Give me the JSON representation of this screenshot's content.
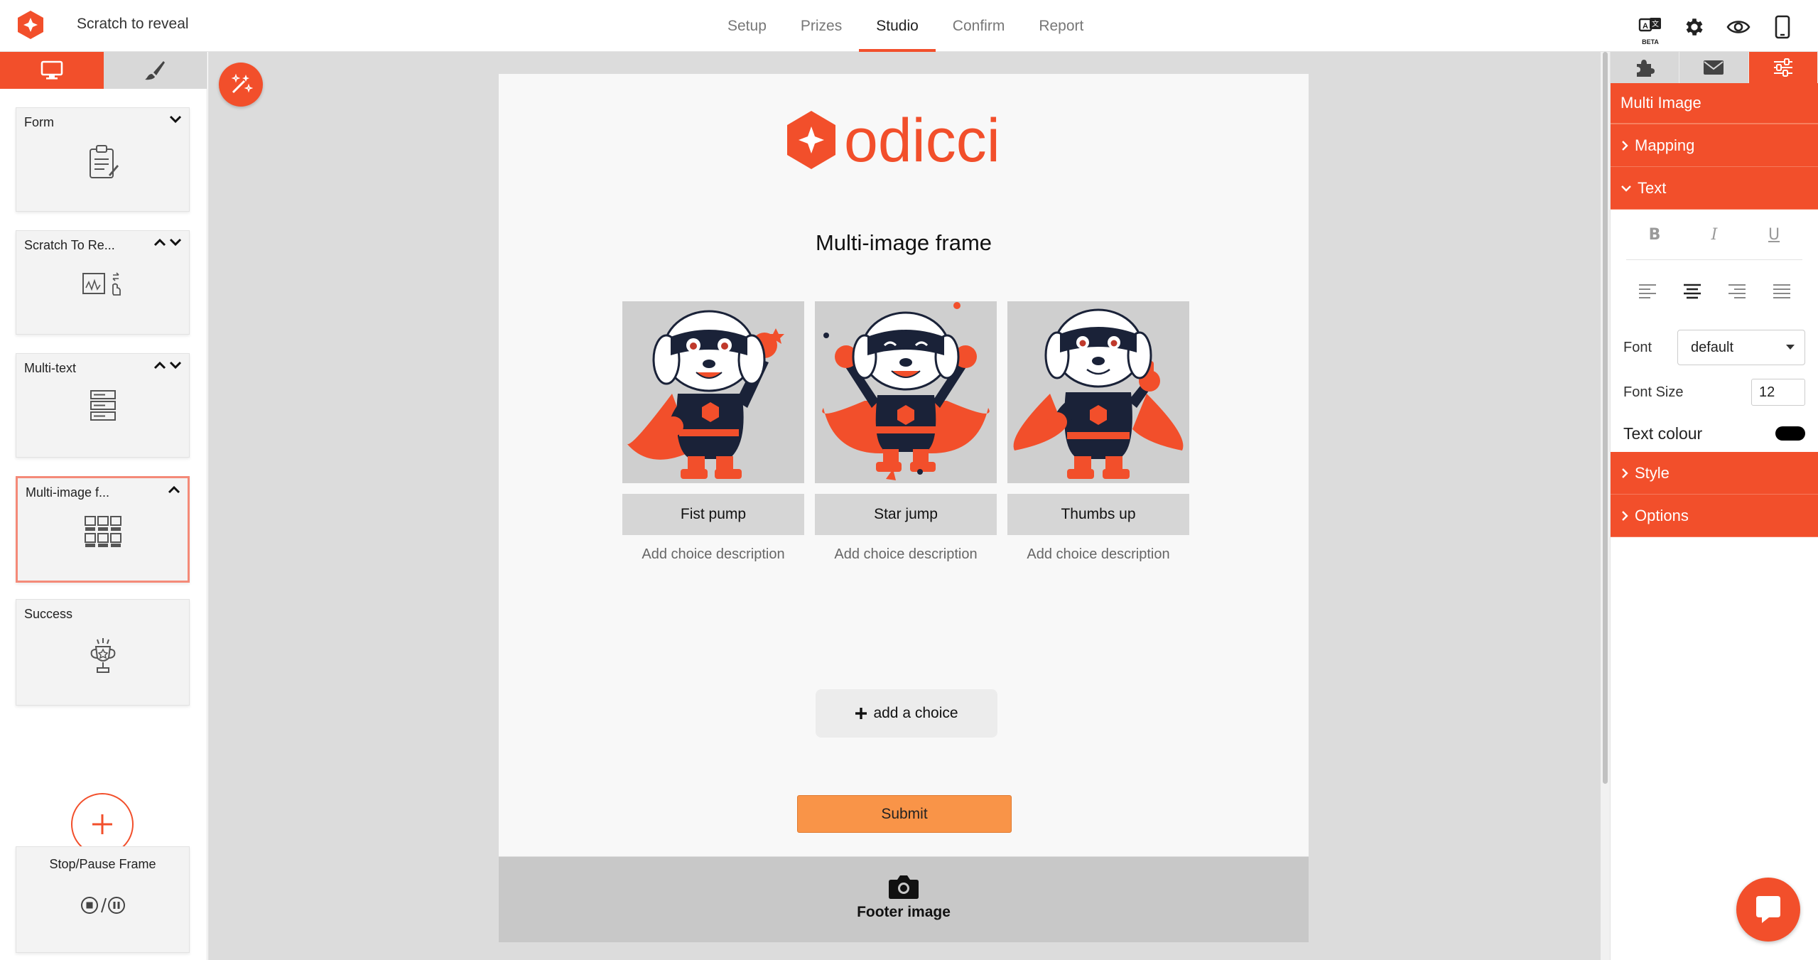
{
  "app": {
    "title": "Scratch to reveal"
  },
  "nav": {
    "tabs": [
      {
        "label": "Setup"
      },
      {
        "label": "Prizes"
      },
      {
        "label": "Studio",
        "active": true
      },
      {
        "label": "Confirm"
      },
      {
        "label": "Report"
      }
    ]
  },
  "topbar_icons": {
    "beta_label": "BETA",
    "icons": [
      "translate-icon",
      "gear-icon",
      "eye-icon",
      "mobile-icon"
    ]
  },
  "left_sidebar": {
    "tabs": [
      {
        "icon": "desktop-icon",
        "active": true
      },
      {
        "icon": "brush-icon",
        "active": false
      }
    ],
    "frames": [
      {
        "label": "Form",
        "icon": "clipboard-icon"
      },
      {
        "label": "Scratch To Re...",
        "icon": "scratch-icon"
      },
      {
        "label": "Multi-text",
        "icon": "multi-text-icon"
      },
      {
        "label": "Multi-image f...",
        "icon": "multi-image-icon",
        "selected": true
      },
      {
        "label": "Success",
        "icon": "trophy-icon"
      }
    ],
    "stop_frame": {
      "label": "Stop/Pause Frame"
    }
  },
  "preview": {
    "brand": "odicci",
    "heading": "Multi-image frame",
    "choices": [
      {
        "name": "Fist pump",
        "description": "Add choice description"
      },
      {
        "name": "Star jump",
        "description": "Add choice description"
      },
      {
        "name": "Thumbs up",
        "description": "Add choice description"
      }
    ],
    "add_choice_label": "add a choice",
    "submit_label": "Submit",
    "footer_label": "Footer image"
  },
  "right_panel": {
    "tabs": [
      "puzzle-icon",
      "envelope-icon",
      "sliders-icon"
    ],
    "header": "Multi Image",
    "sections": {
      "mapping": "Mapping",
      "text": "Text",
      "style": "Style",
      "options": "Options"
    },
    "text_format": {
      "bold": "B",
      "italic": "I",
      "underline": "U"
    },
    "font_label": "Font",
    "font_value": "default",
    "font_size_label": "Font Size",
    "font_size_value": "12",
    "text_colour_label": "Text colour",
    "text_colour_value": "#000000"
  },
  "colors": {
    "accent": "#f24f2b",
    "submit": "#f99448",
    "canvas": "#dcdcdc"
  }
}
